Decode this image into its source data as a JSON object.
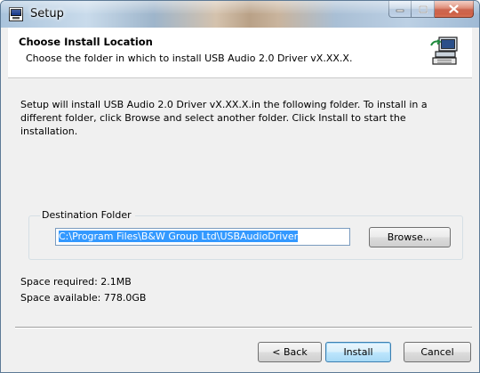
{
  "window": {
    "title": "Setup"
  },
  "header": {
    "title": "Choose Install Location",
    "subtitle_prefix": "Choose the folder in which to install USB Audio 2.0 Driver ",
    "subtitle_version": "vX.XX.X",
    "subtitle_suffix": "."
  },
  "intro": {
    "prefix": "Setup will install USB Audio 2.0 Driver ",
    "version": "vX.XX.X",
    "suffix": ".in the following folder. To install in a different folder, click Browse and select another folder. Click Install to start the installation."
  },
  "destination": {
    "legend": "Destination Folder",
    "path": "C:\\Program Files\\B&W Group Ltd\\USBAudioDriver",
    "browse_label": "Browse..."
  },
  "space": {
    "required": "Space required: 2.1MB",
    "available": "Space available: 778.0GB"
  },
  "buttons": {
    "back": "< Back",
    "install": "Install",
    "cancel": "Cancel"
  },
  "icons": {
    "app": "setup-app-icon",
    "header": "installer-computer-icon",
    "minimize": "minimize-icon",
    "maximize": "maximize-icon",
    "close": "close-icon"
  },
  "colors": {
    "selection": "#3399ff",
    "close_button": "#c2462b",
    "default_button_border": "#3c7fb1"
  }
}
